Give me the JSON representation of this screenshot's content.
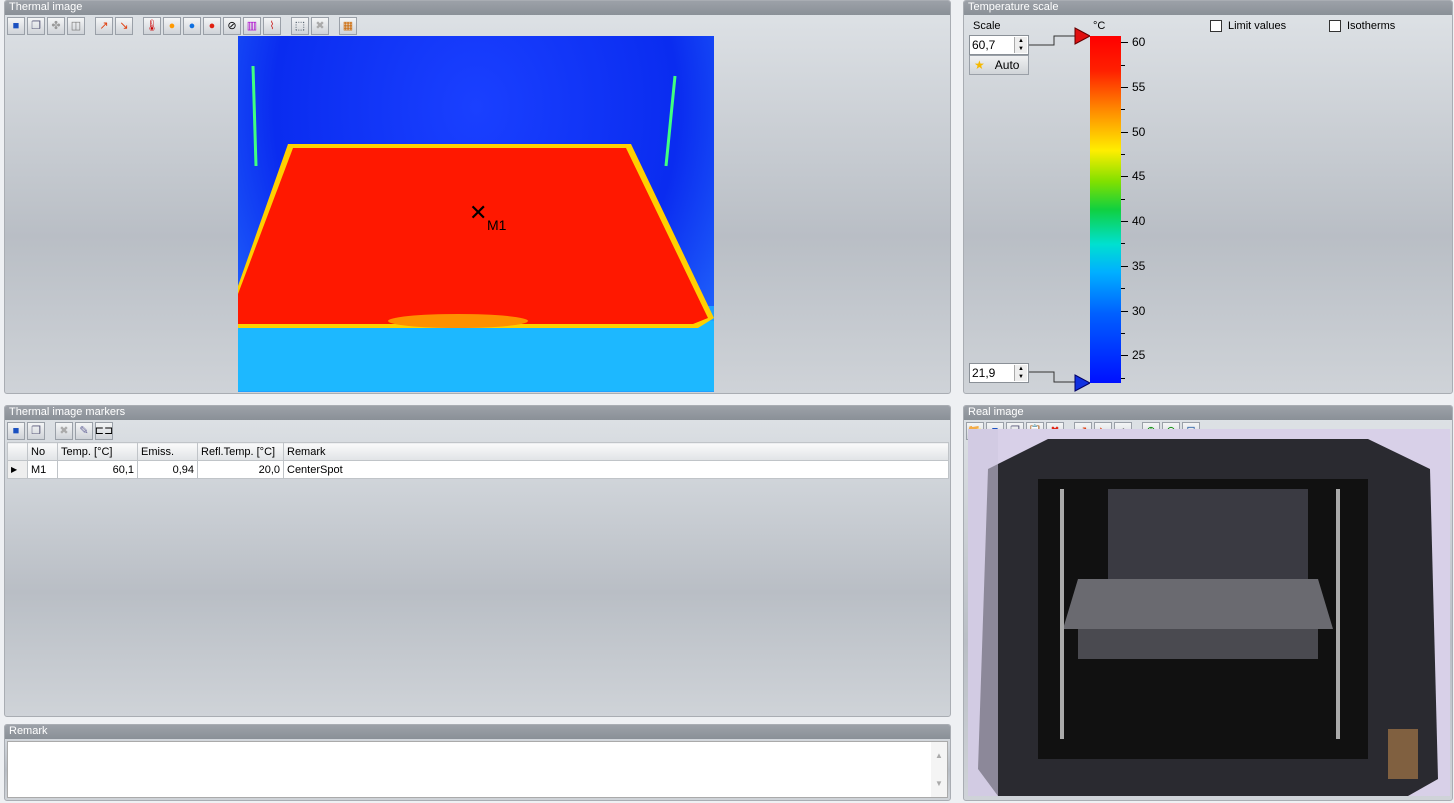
{
  "thermal_panel": {
    "title": "Thermal image",
    "marker_label": "M1",
    "toolbar": [
      "save-icon",
      "copy-icon",
      "puzzle-icon",
      "window-icon",
      "rotate-left-icon",
      "rotate-right-icon",
      "thermometer-icon",
      "sun-icon",
      "blue-dot-icon",
      "red-dot-icon",
      "no-icon",
      "histogram-icon",
      "profile-icon",
      "selection-icon",
      "delete-icon",
      "grid-icon"
    ]
  },
  "scale_panel": {
    "title": "Temperature scale",
    "scale_label": "Scale",
    "max_value": "60,7",
    "min_value": "21,9",
    "auto_label": "Auto",
    "unit": "°C",
    "limit_values_label": "Limit values",
    "isotherms_label": "Isotherms",
    "range": [
      21.9,
      60.7
    ],
    "ticks": [
      "60",
      "55",
      "50",
      "45",
      "40",
      "35",
      "30",
      "25"
    ]
  },
  "markers_panel": {
    "title": "Thermal image markers",
    "columns": [
      "No",
      "Temp. [°C]",
      "Emiss.",
      "Refl.Temp. [°C]",
      "Remark"
    ],
    "rows": [
      {
        "no": "M1",
        "temp": "60,1",
        "emiss": "0,94",
        "refl": "20,0",
        "remark": "CenterSpot"
      }
    ]
  },
  "remark_panel": {
    "title": "Remark",
    "value": ""
  },
  "real_panel": {
    "title": "Real image"
  }
}
